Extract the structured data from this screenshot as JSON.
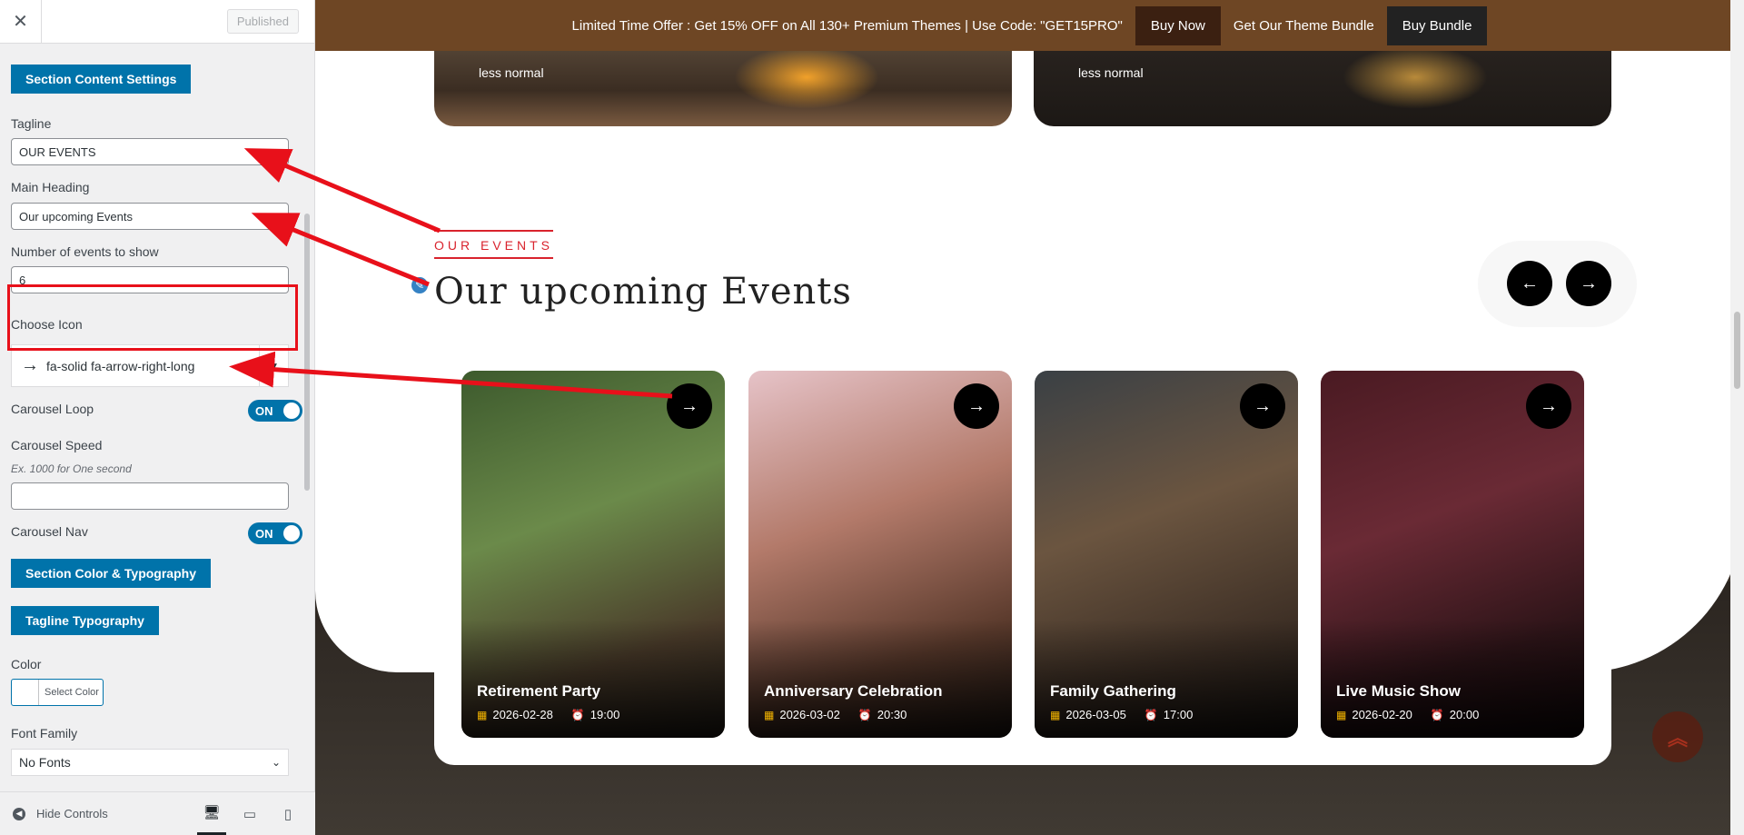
{
  "sidebar": {
    "close_icon": "close-icon",
    "published_label": "Published",
    "section_content_label": "Section Content Settings",
    "tagline_label": "Tagline",
    "tagline_value": "OUR EVENTS",
    "main_heading_label": "Main Heading",
    "main_heading_value": "Our upcoming Events",
    "num_events_label": "Number of events to show",
    "num_events_value": "6",
    "choose_icon_label": "Choose Icon",
    "icon_glyph": "→",
    "icon_value": "fa-solid fa-arrow-right-long",
    "carousel_loop_label": "Carousel Loop",
    "carousel_loop_toggle": "ON",
    "carousel_speed_label": "Carousel Speed",
    "carousel_speed_hint": "Ex. 1000 for One second",
    "carousel_speed_value": "",
    "carousel_nav_label": "Carousel Nav",
    "carousel_nav_toggle": "ON",
    "section_color_label": "Section Color & Typography",
    "tagline_typo_label": "Tagline Typography",
    "color_label": "Color",
    "select_color_label": "Select Color",
    "font_family_label": "Font Family",
    "font_family_value": "No Fonts",
    "hide_controls_label": "Hide Controls",
    "accent_color": "#0073aa"
  },
  "preview": {
    "promo_text": "Limited Time Offer : Get 15% OFF on All 130+ Premium Themes | Use Code: \"GET15PRO\"",
    "buy_now": "Buy Now",
    "bundle_text": "Get Our Theme Bundle",
    "buy_bundle": "Buy Bundle",
    "top_card_text": "less normal",
    "tagline": "OUR EVENTS",
    "heading": "Our upcoming Events",
    "prev_arrow": "←",
    "next_arrow": "→",
    "scroll_top": "︽",
    "events": [
      {
        "title": "Retirement Party",
        "date": "2026-02-28",
        "time": "19:00"
      },
      {
        "title": "Anniversary Celebration",
        "date": "2026-03-02",
        "time": "20:30"
      },
      {
        "title": "Family Gathering",
        "date": "2026-03-05",
        "time": "17:00"
      },
      {
        "title": "Live Music Show",
        "date": "2026-02-20",
        "time": "20:00"
      }
    ],
    "tagline_color": "#d9232d",
    "promo_color": "#6e4624",
    "annotation_arrow_color": "#e8101a"
  }
}
